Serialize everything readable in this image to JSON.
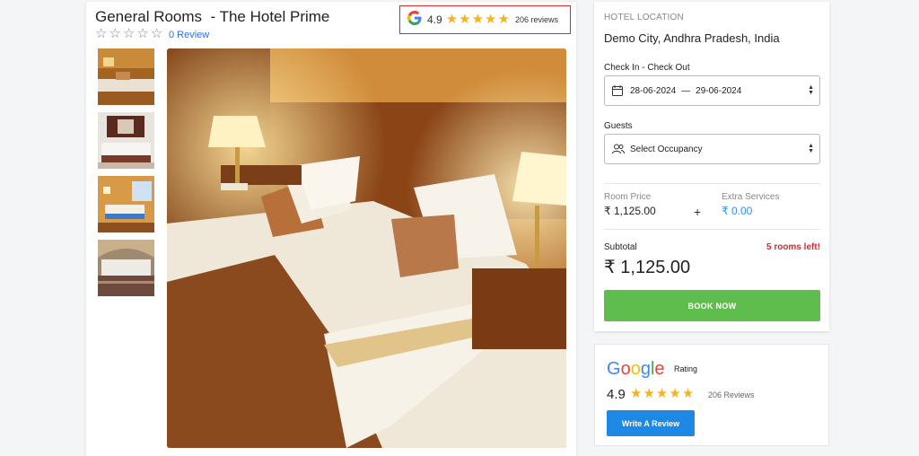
{
  "room": {
    "title": "General Rooms  - The Hotel Prime",
    "stars_filled": 0,
    "stars_total": 5,
    "review_link": "0 Review"
  },
  "google_badge": {
    "rating": "4.9",
    "stars": 5,
    "reviews": "206 reviews",
    "border_color": "#e0262b",
    "star_color": "#f6b321"
  },
  "gallery": {
    "thumbnails": [
      "hotel-room-thumb-1",
      "hotel-room-thumb-2",
      "hotel-room-thumb-3",
      "hotel-room-thumb-4"
    ]
  },
  "booking": {
    "location_label": "HOTEL LOCATION",
    "location_value": "Demo City, Andhra Pradesh, India",
    "checkin_label": "Check In - Check Out",
    "checkin_date": "28-06-2024",
    "date_separator": "—",
    "checkout_date": "29-06-2024",
    "guests_label": "Guests",
    "guests_placeholder": "Select Occupancy",
    "room_price_label": "Room Price",
    "room_price_value": "₹ 1,125.00",
    "plus": "+",
    "extra_label": "Extra Services",
    "extra_value": "₹ 0.00",
    "subtotal_label": "Subtotal",
    "rooms_left": "5 rooms left!",
    "subtotal_value": "₹ 1,125.00",
    "book_label": "BOOK NOW",
    "book_color": "#5ebd4c"
  },
  "google_card": {
    "logo_letters": [
      "G",
      "o",
      "o",
      "g",
      "l",
      "e"
    ],
    "rating_word": "Rating",
    "score": "4.9",
    "stars": 5,
    "count": "206 Reviews",
    "write_label": "Write A Review",
    "write_color": "#1e88e5"
  }
}
